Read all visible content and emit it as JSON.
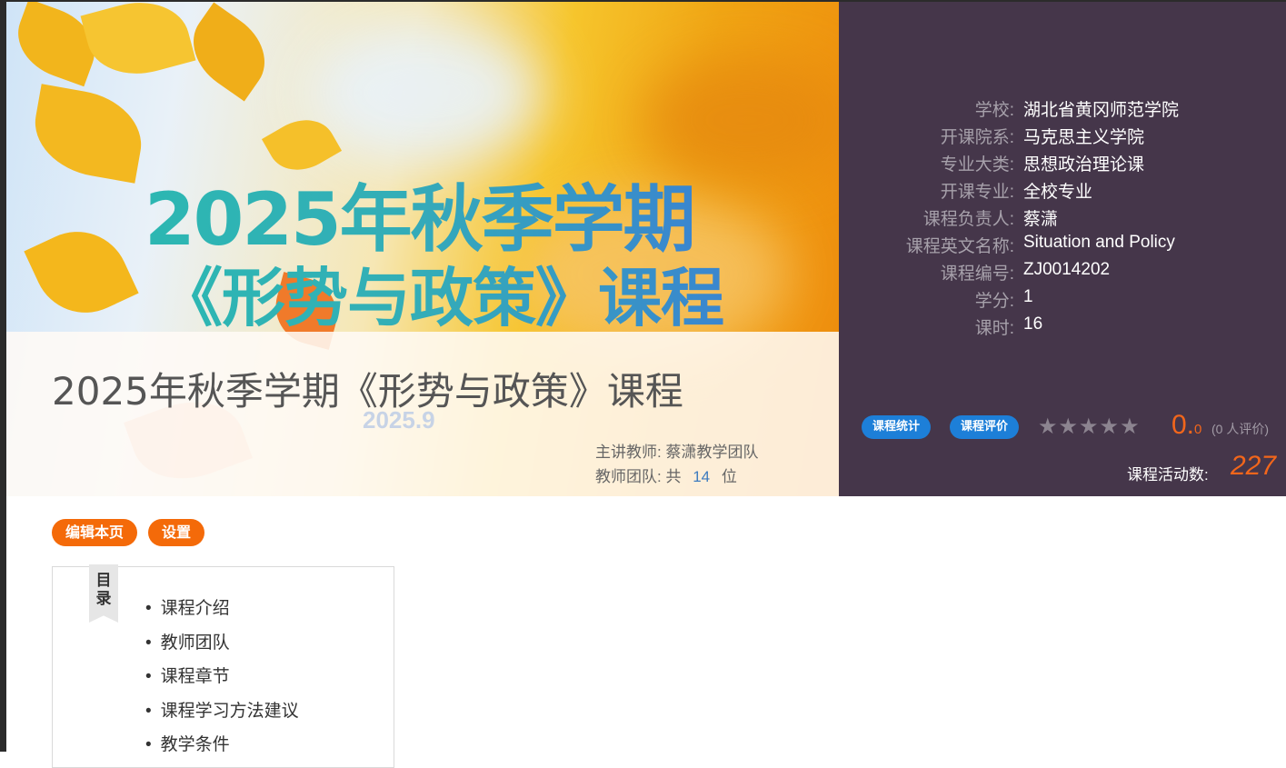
{
  "banner": {
    "title_line1": "2025年秋季学期",
    "title_line2": "《形势与政策》课程",
    "course_title": "2025年秋季学期《形势与政策》课程",
    "ghost_date": "2025.9",
    "lead_teacher_label": "主讲教师:",
    "lead_teacher": "蔡潇教学团队",
    "team_label": "教师团队:",
    "team_prefix": "共",
    "team_count": "14",
    "team_suffix": "位"
  },
  "info": {
    "rows": [
      {
        "label": "学校:",
        "value": "湖北省黄冈师范学院"
      },
      {
        "label": "开课院系:",
        "value": "马克思主义学院"
      },
      {
        "label": "专业大类:",
        "value": "思想政治理论课"
      },
      {
        "label": "开课专业:",
        "value": "全校专业"
      },
      {
        "label": "课程负责人:",
        "value": "蔡潇"
      },
      {
        "label": "课程英文名称:",
        "value": "Situation and Policy"
      },
      {
        "label": "课程编号:",
        "value": "ZJ0014202"
      },
      {
        "label": "学分:",
        "value": "1"
      },
      {
        "label": "课时:",
        "value": "16"
      }
    ],
    "stats_button": "课程统计",
    "review_button": "课程评价",
    "stars_total": 5,
    "stars_filled": 0,
    "rating_main": "0.",
    "rating_decimal": "0",
    "rating_count": "(0 人评价)",
    "activity_label": "课程活动数:",
    "activity_value": "227"
  },
  "actions": {
    "edit": "编辑本页",
    "settings": "设置"
  },
  "toc": {
    "ribbon_1": "目",
    "ribbon_2": "录",
    "items": [
      "课程介绍",
      "教师团队",
      "课程章节",
      "课程学习方法建议",
      "教学条件"
    ]
  },
  "colors": {
    "panel_bg": "#45364a",
    "accent_orange": "#f46a09",
    "pill_blue": "#1d7fd8"
  }
}
